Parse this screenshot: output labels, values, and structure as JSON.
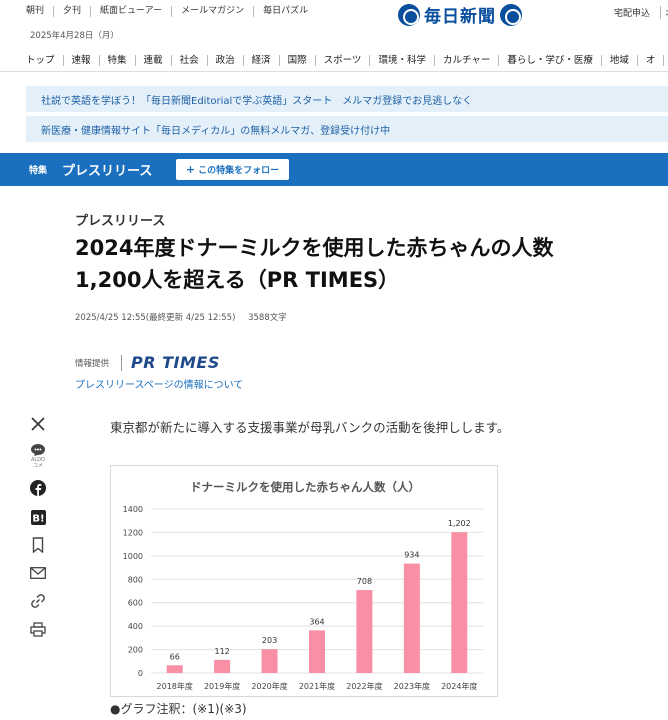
{
  "header": {
    "links": [
      "朝刊",
      "夕刊",
      "紙面ビューアー",
      "メールマガジン",
      "毎日パズル"
    ],
    "brand": "毎日新聞",
    "delivery": "宅配申込",
    "delivery_cut": "オ",
    "date": "2025年4月28日（月）"
  },
  "nav": {
    "items": [
      "トップ",
      "速報",
      "特集",
      "連載",
      "社会",
      "政治",
      "経済",
      "国際",
      "スポーツ",
      "環境・科学",
      "カルチャー",
      "暮らし・学び・医療",
      "地域",
      "オ"
    ]
  },
  "notices": [
    "社説で英語を学ぼう！「毎日新聞Editorialで学ぶ英語」スタート　メルマガ登録でお見逃しなく",
    "新医療・健康情報サイト「毎日メディカル」の無料メルマガ、登録受け付け中"
  ],
  "feature": {
    "tag": "特集",
    "title": "プレスリリース",
    "follow_label": "この特集をフォロー"
  },
  "article": {
    "kicker": "プレスリリース",
    "headline_line1": "2024年度ドナーミルクを使用した赤ちゃんの人数",
    "headline_line2": "1,200人を超える（PR TIMES）",
    "published": "2025/4/25 12:55(最終更新 4/25 12:55)",
    "char_count": "3588文字",
    "provider_label": "情報提供",
    "provider_name": "PR TIMES",
    "provider_link": "プレスリリースページの情報について",
    "lead": "東京都が新たに導入する支援事業が母乳バンクの活動を後押しします。",
    "footnote": "●グラフ注釈：(※1)(※3)"
  },
  "share": {
    "icons": [
      "x-icon",
      "comment-icon",
      "facebook-icon",
      "hatena-icon",
      "bookmark-icon",
      "mail-icon",
      "link-icon",
      "print-icon"
    ],
    "comment_caption": "ALDO\nコメ"
  },
  "chart_data": {
    "type": "bar",
    "title": "ドナーミルクを使用した赤ちゃん人数（人）",
    "categories": [
      "2018年度",
      "2019年度",
      "2020年度",
      "2021年度",
      "2022年度",
      "2023年度",
      "2024年度"
    ],
    "values": [
      66,
      112,
      203,
      364,
      708,
      934,
      1202
    ],
    "data_labels": [
      "66",
      "112",
      "203",
      "364",
      "708",
      "934",
      "1,202"
    ],
    "yticks": [
      "0",
      "200",
      "400",
      "600",
      "800",
      "1000",
      "1200",
      "1400"
    ],
    "ylim": [
      0,
      1400
    ],
    "bar_color": "#f98fa5",
    "grid": true,
    "xlabel": "",
    "ylabel": ""
  },
  "colors": {
    "brand_blue": "#0a4f9e",
    "band_blue": "#1a6fbf",
    "notice_bg": "#e3f0f9",
    "bar": "#f98fa5"
  }
}
